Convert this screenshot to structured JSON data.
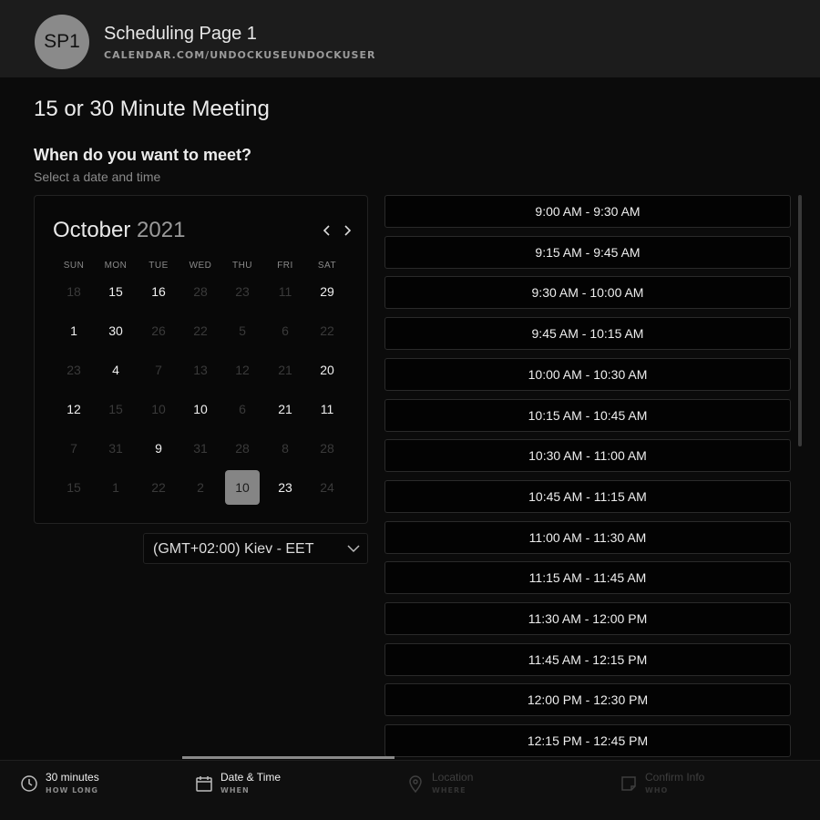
{
  "header": {
    "avatar_initials": "SP1",
    "page_name": "Scheduling Page 1",
    "url": "CALENDAR.COM/UNDOCKUSEUNDOCKUSER"
  },
  "meeting_title": "15 or 30 Minute Meeting",
  "prompt": {
    "question": "When do you want to meet?",
    "hint": "Select a date and time"
  },
  "calendar": {
    "month": "October",
    "year": "2021",
    "weekdays": [
      "SUN",
      "MON",
      "TUE",
      "WED",
      "THU",
      "FRI",
      "SAT"
    ],
    "weeks": [
      [
        {
          "d": "18",
          "s": "muted"
        },
        {
          "d": "15",
          "s": "avail"
        },
        {
          "d": "16",
          "s": "avail"
        },
        {
          "d": "28",
          "s": "muted"
        },
        {
          "d": "23",
          "s": "muted"
        },
        {
          "d": "11",
          "s": "muted"
        },
        {
          "d": "29",
          "s": "avail"
        }
      ],
      [
        {
          "d": "1",
          "s": "avail"
        },
        {
          "d": "30",
          "s": "avail"
        },
        {
          "d": "26",
          "s": "muted"
        },
        {
          "d": "22",
          "s": "muted"
        },
        {
          "d": "5",
          "s": "muted"
        },
        {
          "d": "6",
          "s": "muted"
        },
        {
          "d": "22",
          "s": "muted"
        }
      ],
      [
        {
          "d": "23",
          "s": "muted"
        },
        {
          "d": "4",
          "s": "avail"
        },
        {
          "d": "7",
          "s": "muted"
        },
        {
          "d": "13",
          "s": "muted"
        },
        {
          "d": "12",
          "s": "muted"
        },
        {
          "d": "21",
          "s": "muted"
        },
        {
          "d": "20",
          "s": "avail"
        }
      ],
      [
        {
          "d": "12",
          "s": "avail"
        },
        {
          "d": "15",
          "s": "muted"
        },
        {
          "d": "10",
          "s": "muted"
        },
        {
          "d": "10",
          "s": "avail"
        },
        {
          "d": "6",
          "s": "muted"
        },
        {
          "d": "21",
          "s": "avail"
        },
        {
          "d": "11",
          "s": "avail"
        }
      ],
      [
        {
          "d": "7",
          "s": "muted"
        },
        {
          "d": "31",
          "s": "muted"
        },
        {
          "d": "9",
          "s": "avail"
        },
        {
          "d": "31",
          "s": "muted"
        },
        {
          "d": "28",
          "s": "muted"
        },
        {
          "d": "8",
          "s": "muted"
        },
        {
          "d": "28",
          "s": "muted"
        }
      ],
      [
        {
          "d": "15",
          "s": "muted"
        },
        {
          "d": "1",
          "s": "muted"
        },
        {
          "d": "22",
          "s": "muted"
        },
        {
          "d": "2",
          "s": "muted"
        },
        {
          "d": "10",
          "s": "selected"
        },
        {
          "d": "23",
          "s": "avail"
        },
        {
          "d": "24",
          "s": "muted"
        }
      ]
    ]
  },
  "timezone": "(GMT+02:00) Kiev - EET",
  "time_slots": [
    "9:00 AM - 9:30 AM",
    "9:15 AM - 9:45 AM",
    "9:30 AM - 10:00 AM",
    "9:45 AM - 10:15 AM",
    "10:00 AM - 10:30 AM",
    "10:15 AM - 10:45 AM",
    "10:30 AM - 11:00 AM",
    "10:45 AM - 11:15 AM",
    "11:00 AM - 11:30 AM",
    "11:15 AM - 11:45 AM",
    "11:30 AM - 12:00 PM",
    "11:45 AM - 12:15 PM",
    "12:00 PM - 12:30 PM",
    "12:15 PM - 12:45 PM"
  ],
  "footer": {
    "steps": [
      {
        "label": "30 minutes",
        "sub": "HOW LONG",
        "icon": "clock-icon",
        "state": "active"
      },
      {
        "label": "Date & Time",
        "sub": "WHEN",
        "icon": "calendar-icon",
        "state": "active"
      },
      {
        "label": "Location",
        "sub": "WHERE",
        "icon": "location-pin-icon",
        "state": "inactive"
      },
      {
        "label": "Confirm Info",
        "sub": "WHO",
        "icon": "note-icon",
        "state": "inactive"
      }
    ]
  },
  "colors": {
    "background": "#0b0b0b",
    "header_bg": "#1c1c1c",
    "selected_day": "#858585"
  }
}
